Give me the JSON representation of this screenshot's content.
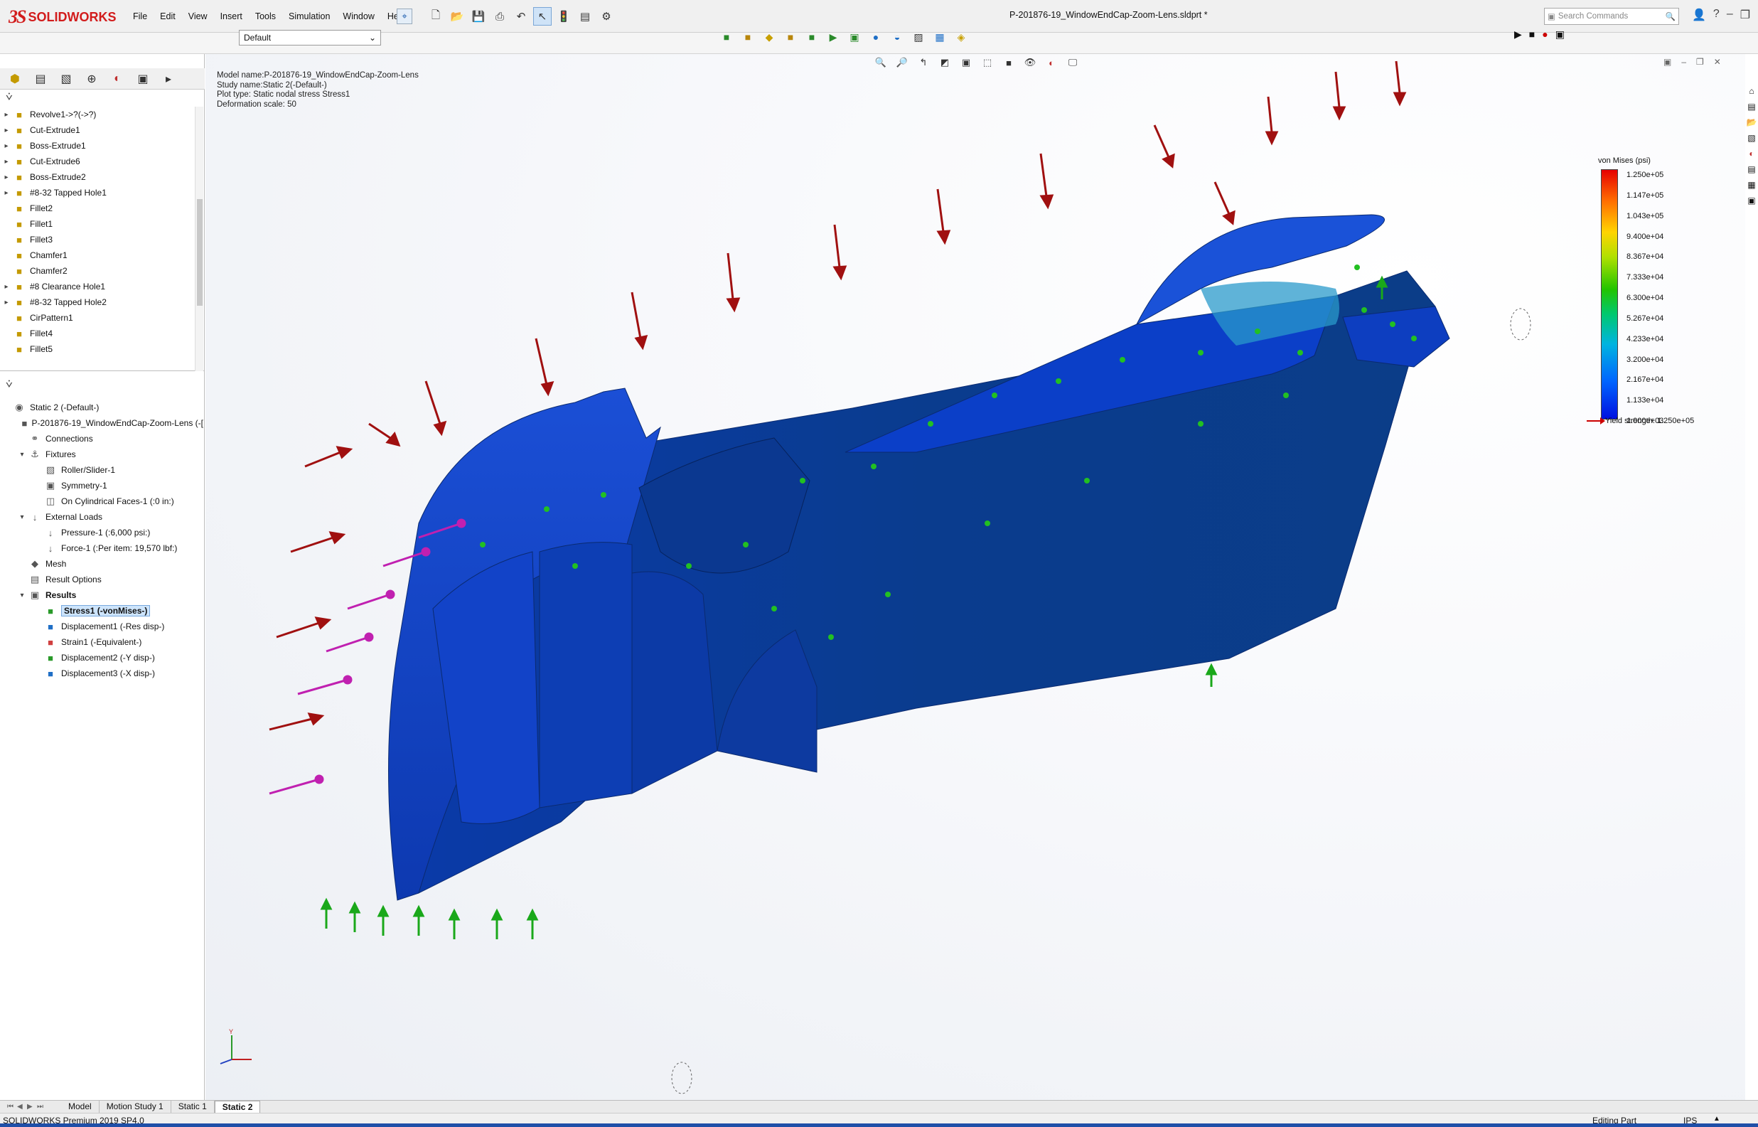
{
  "app": {
    "brand_ds": "3S",
    "brand_name": "SOLIDWORKS",
    "menus": [
      "File",
      "Edit",
      "View",
      "Insert",
      "Tools",
      "Simulation",
      "Window",
      "Help"
    ],
    "document_title": "P-201876-19_WindowEndCap-Zoom-Lens.sldprt *",
    "search_placeholder": "Search Commands",
    "help_label": "?"
  },
  "config_selector": {
    "value": "Default"
  },
  "feature_tree": {
    "items": [
      {
        "label": "Revolve1->?(->?)",
        "expand": true
      },
      {
        "label": "Cut-Extrude1",
        "expand": true
      },
      {
        "label": "Boss-Extrude1",
        "expand": true
      },
      {
        "label": "Cut-Extrude6",
        "expand": true
      },
      {
        "label": "Boss-Extrude2",
        "expand": true
      },
      {
        "label": "#8-32 Tapped Hole1",
        "expand": true
      },
      {
        "label": "Fillet2",
        "expand": false
      },
      {
        "label": "Fillet1",
        "expand": false
      },
      {
        "label": "Fillet3",
        "expand": false
      },
      {
        "label": "Chamfer1",
        "expand": false
      },
      {
        "label": "Chamfer2",
        "expand": false
      },
      {
        "label": "#8 Clearance Hole1",
        "expand": true
      },
      {
        "label": "#8-32 Tapped Hole2",
        "expand": true
      },
      {
        "label": "CirPattern1",
        "expand": false
      },
      {
        "label": "Fillet4",
        "expand": false
      },
      {
        "label": "Fillet5",
        "expand": false
      }
    ]
  },
  "sim_tree": {
    "items": [
      {
        "label": "Static 2 (-Default-)",
        "indent": 0,
        "expand": ""
      },
      {
        "label": "P-201876-19_WindowEndCap-Zoom-Lens (-[",
        "indent": 1,
        "expand": ""
      },
      {
        "label": "Connections",
        "indent": 1,
        "expand": ""
      },
      {
        "label": "Fixtures",
        "indent": 1,
        "expand": "▾"
      },
      {
        "label": "Roller/Slider-1",
        "indent": 2,
        "expand": ""
      },
      {
        "label": "Symmetry-1",
        "indent": 2,
        "expand": ""
      },
      {
        "label": "On Cylindrical Faces-1 (:0 in:)",
        "indent": 2,
        "expand": ""
      },
      {
        "label": "External Loads",
        "indent": 1,
        "expand": "▾"
      },
      {
        "label": "Pressure-1 (:6,000 psi:)",
        "indent": 2,
        "expand": ""
      },
      {
        "label": "Force-1 (:Per item: 19,570 lbf:)",
        "indent": 2,
        "expand": ""
      },
      {
        "label": "Mesh",
        "indent": 1,
        "expand": ""
      },
      {
        "label": "Result Options",
        "indent": 1,
        "expand": ""
      },
      {
        "label": "Results",
        "indent": 1,
        "expand": "▾",
        "bold": true
      },
      {
        "label": "Stress1 (-vonMises-)",
        "indent": 2,
        "expand": "",
        "highlight": true
      },
      {
        "label": "Displacement1 (-Res disp-)",
        "indent": 2,
        "expand": ""
      },
      {
        "label": "Strain1 (-Equivalent-)",
        "indent": 2,
        "expand": ""
      },
      {
        "label": "Displacement2 (-Y disp-)",
        "indent": 2,
        "expand": ""
      },
      {
        "label": "Displacement3 (-X disp-)",
        "indent": 2,
        "expand": ""
      }
    ]
  },
  "viewport": {
    "hud": [
      "Model name:P-201876-19_WindowEndCap-Zoom-Lens",
      "Study name:Static 2(-Default-)",
      "Plot type: Static nodal stress Stress1",
      "Deformation scale: 50"
    ],
    "legend": {
      "title": "von Mises (psi)",
      "ticks": [
        "1.250e+05",
        "1.147e+05",
        "1.043e+05",
        "9.400e+04",
        "8.367e+04",
        "7.333e+04",
        "6.300e+04",
        "5.267e+04",
        "4.233e+04",
        "3.200e+04",
        "2.167e+04",
        "1.133e+04",
        "1.000e+03"
      ],
      "gradient_colors": [
        "#e60000",
        "#ff6a00",
        "#ffd400",
        "#22c400",
        "#00b4e0",
        "#0010e0"
      ]
    },
    "yield_label": "Yield strength: 1.250e+05"
  },
  "bottom_tabs": [
    "Model",
    "Motion Study 1",
    "Static 1",
    "Static 2"
  ],
  "active_tab": "Static 2",
  "status": {
    "version": "SOLIDWORKS Premium 2019 SP4.0",
    "mode": "Editing Part",
    "units": "IPS"
  }
}
